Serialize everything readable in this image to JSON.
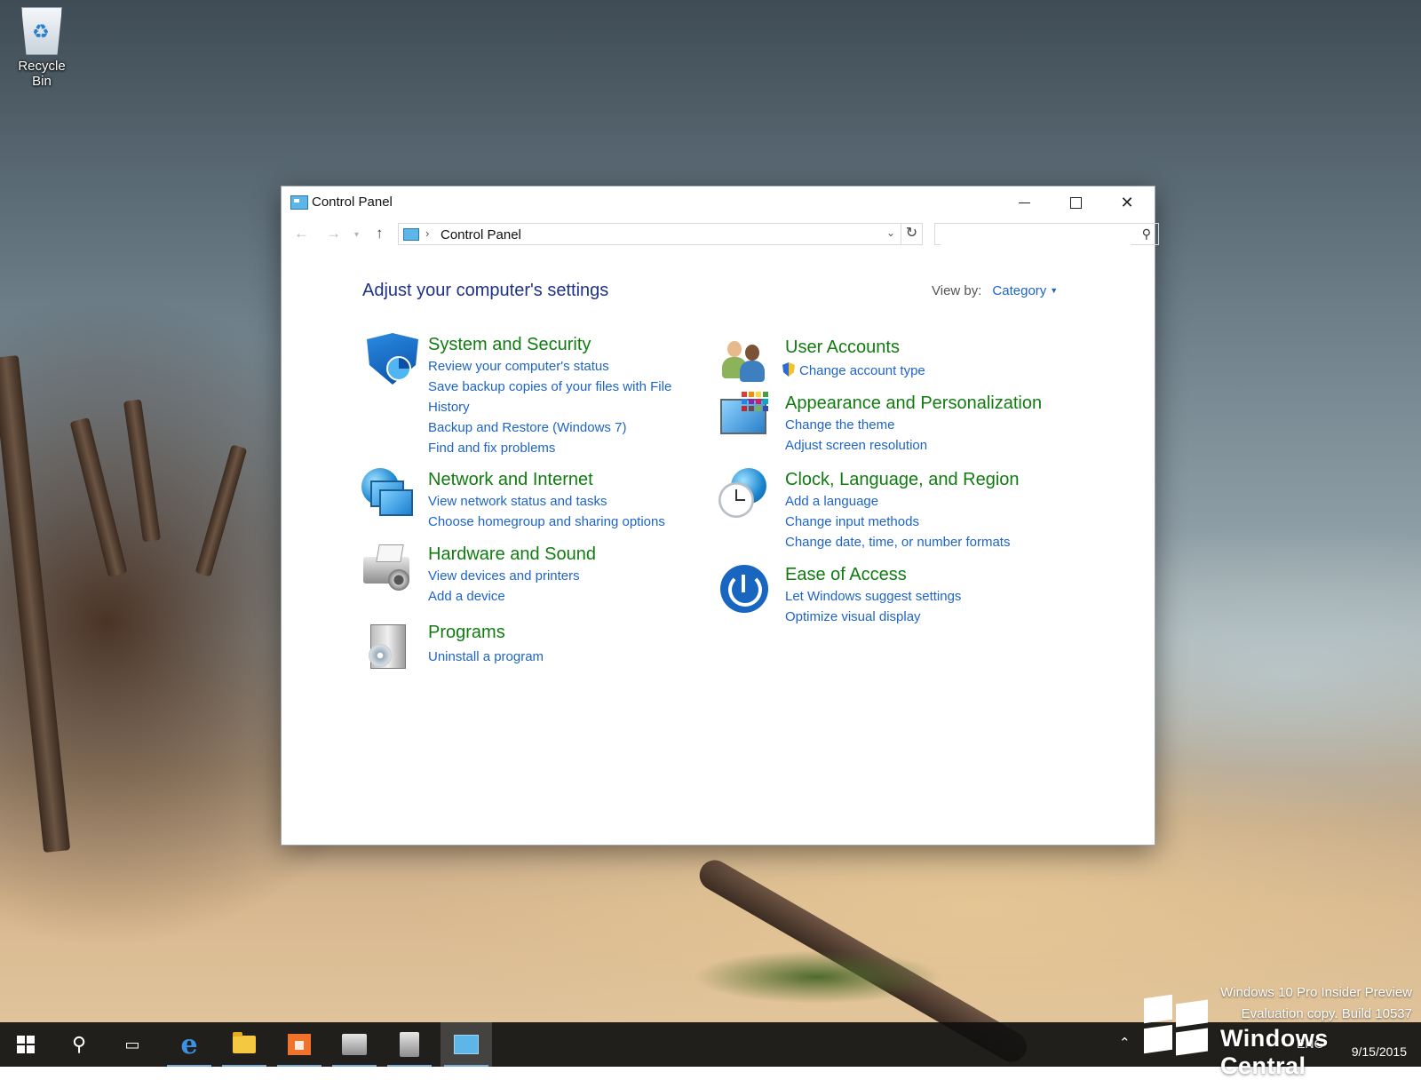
{
  "desktop": {
    "recycle_bin_label": "Recycle Bin",
    "watermark_line1": "Windows 10 Pro Insider Preview",
    "watermark_line2": "Evaluation copy. Build 10537",
    "brand_text": "Windows Central"
  },
  "window": {
    "title": "Control Panel",
    "controls": {
      "minimize": "minimize",
      "maximize": "maximize",
      "close": "close"
    }
  },
  "navbar": {
    "back_icon": "back-arrow-icon",
    "forward_icon": "forward-arrow-icon",
    "up_icon": "up-arrow-icon",
    "breadcrumb": [
      "Control Panel"
    ],
    "search_placeholder": ""
  },
  "content": {
    "heading": "Adjust your computer's settings",
    "view_by_label": "View by:",
    "view_by_value": "Category",
    "categories": [
      {
        "title": "System and Security",
        "icon": "shield-icon",
        "links": [
          "Review your computer's status",
          "Save backup copies of your files with File History",
          "Backup and Restore (Windows 7)",
          "Find and fix problems"
        ]
      },
      {
        "title": "Network and Internet",
        "icon": "network-globe-icon",
        "links": [
          "View network status and tasks",
          "Choose homegroup and sharing options"
        ]
      },
      {
        "title": "Hardware and Sound",
        "icon": "printer-speaker-icon",
        "links": [
          "View devices and printers",
          "Add a device"
        ]
      },
      {
        "title": "Programs",
        "icon": "programs-box-icon",
        "links": [
          "Uninstall a program"
        ]
      },
      {
        "title": "User Accounts",
        "icon": "users-icon",
        "links": [
          "Change account type"
        ]
      },
      {
        "title": "Appearance and Personalization",
        "icon": "palette-monitor-icon",
        "links": [
          "Change the theme",
          "Adjust screen resolution"
        ]
      },
      {
        "title": "Clock, Language, and Region",
        "icon": "clock-globe-icon",
        "links": [
          "Add a language",
          "Change input methods",
          "Change date, time, or number formats"
        ]
      },
      {
        "title": "Ease of Access",
        "icon": "ease-of-access-icon",
        "links": [
          "Let Windows suggest settings",
          "Optimize visual display"
        ]
      }
    ]
  },
  "taskbar": {
    "items": [
      "start-icon",
      "search-icon",
      "task-view-icon",
      "edge-icon",
      "file-explorer-icon",
      "store-icon",
      "devices-printers-icon",
      "programs-icon",
      "control-panel-icon"
    ],
    "tray_language": "ENG",
    "tray_date": "9/15/2015"
  },
  "colors": {
    "heading": "#1e3287",
    "category_title": "#107c10",
    "link": "#1e64c8",
    "taskbar": "#101010"
  }
}
